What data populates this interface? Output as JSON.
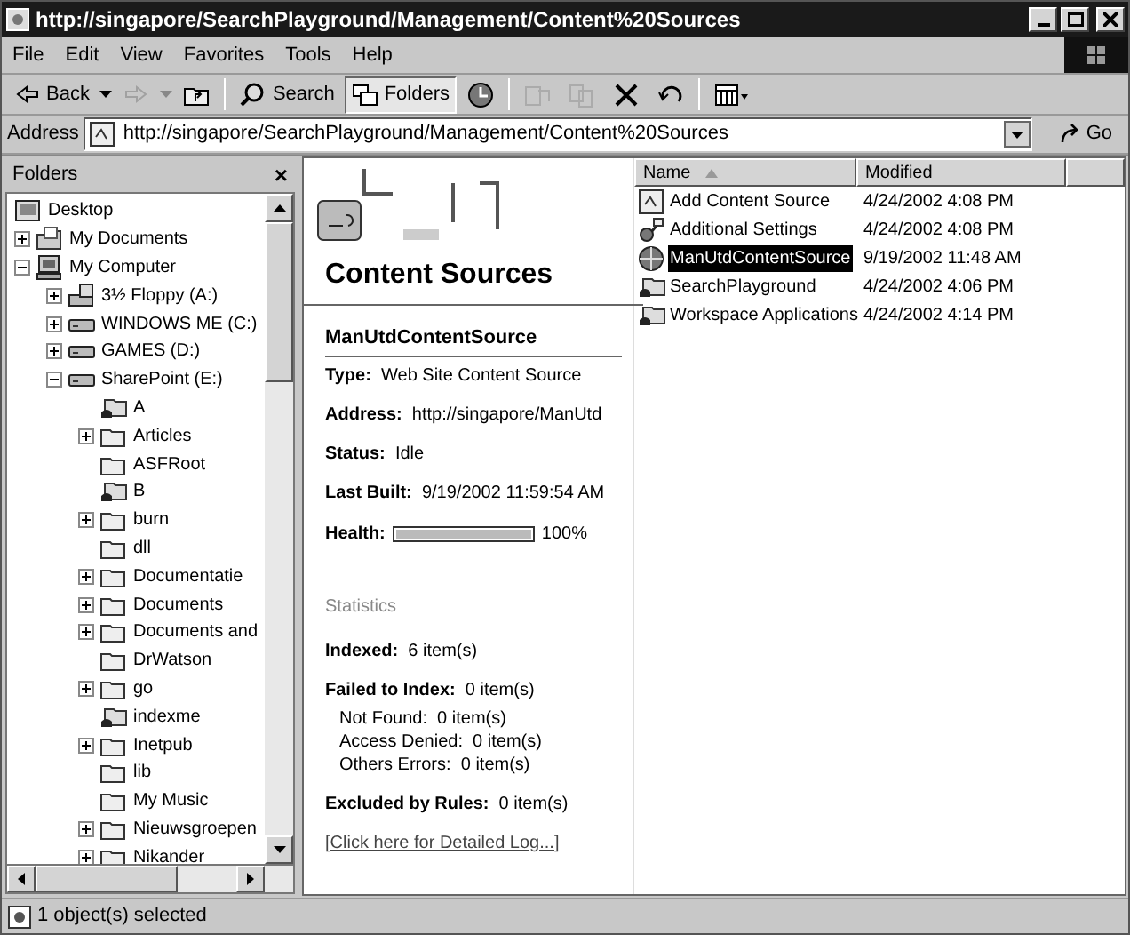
{
  "window": {
    "title": "http://singapore/SearchPlayground/Management/Content%20Sources"
  },
  "menu": [
    {
      "label": "File"
    },
    {
      "label": "Edit"
    },
    {
      "label": "View"
    },
    {
      "label": "Favorites"
    },
    {
      "label": "Tools"
    },
    {
      "label": "Help"
    }
  ],
  "toolbar": [
    {
      "kind": "back",
      "label": "Back",
      "disabled": false,
      "pressed": false
    },
    {
      "kind": "forward",
      "disabled": true,
      "pressed": false
    },
    {
      "kind": "up",
      "disabled": false,
      "pressed": false
    },
    {
      "kind": "search",
      "label": "Search",
      "disabled": false,
      "pressed": false
    },
    {
      "kind": "folders",
      "label": "Folders",
      "disabled": false,
      "pressed": true
    },
    {
      "kind": "history",
      "disabled": false,
      "pressed": false
    },
    {
      "kind": "move",
      "disabled": true,
      "pressed": false
    },
    {
      "kind": "copy",
      "disabled": true,
      "pressed": false
    },
    {
      "kind": "delete",
      "disabled": false,
      "pressed": false
    },
    {
      "kind": "undo",
      "disabled": false,
      "pressed": false
    },
    {
      "kind": "views",
      "disabled": false,
      "pressed": false
    }
  ],
  "address": {
    "label": "Address",
    "value": "http://singapore/SearchPlayground/Management/Content%20Sources",
    "go": "Go"
  },
  "folders": {
    "title": "Folders",
    "close": "×",
    "tree": [
      {
        "kind": "desktop",
        "label": "Desktop",
        "children": [
          {
            "kind": "documents",
            "label": "My Documents",
            "expanded": false
          },
          {
            "kind": "computer",
            "label": "My Computer",
            "expanded": true,
            "children": [
              {
                "kind": "floppy",
                "label": "3½ Floppy (A:)",
                "expanded": false
              },
              {
                "kind": "drive",
                "label": "WINDOWS ME (C:)",
                "expanded": false
              },
              {
                "kind": "drive",
                "label": "GAMES (D:)",
                "expanded": false
              },
              {
                "kind": "drive",
                "label": "SharePoint (E:)",
                "expanded": true,
                "children": [
                  {
                    "kind": "shared",
                    "label": "A"
                  },
                  {
                    "kind": "folder",
                    "label": "Articles",
                    "expanded": false
                  },
                  {
                    "kind": "folder",
                    "label": "ASFRoot"
                  },
                  {
                    "kind": "shared",
                    "label": "B"
                  },
                  {
                    "kind": "folder",
                    "label": "burn",
                    "expanded": false
                  },
                  {
                    "kind": "folder",
                    "label": "dll"
                  },
                  {
                    "kind": "folder",
                    "label": "Documentatie",
                    "expanded": false
                  },
                  {
                    "kind": "folder",
                    "label": "Documents",
                    "expanded": false
                  },
                  {
                    "kind": "folder",
                    "label": "Documents and",
                    "expanded": false
                  },
                  {
                    "kind": "folder",
                    "label": "DrWatson"
                  },
                  {
                    "kind": "folder",
                    "label": "go",
                    "expanded": false
                  },
                  {
                    "kind": "shared",
                    "label": "indexme"
                  },
                  {
                    "kind": "folder",
                    "label": "Inetpub",
                    "expanded": false
                  },
                  {
                    "kind": "folder",
                    "label": "lib"
                  },
                  {
                    "kind": "folder",
                    "label": "My Music"
                  },
                  {
                    "kind": "folder",
                    "label": "Nieuwsgroepen",
                    "expanded": false
                  },
                  {
                    "kind": "folder",
                    "label": "Nikander",
                    "expanded": false
                  }
                ]
              }
            ]
          }
        ]
      }
    ]
  },
  "webview": {
    "title": "Content Sources",
    "item": "ManUtdContentSource",
    "fields": [
      {
        "label": "Type:",
        "value": "Web Site Content Source"
      },
      {
        "label": "Address:",
        "value": "http://singapore/ManUtd"
      },
      {
        "label": "Status:",
        "value": "Idle"
      },
      {
        "label": "Last Built:",
        "value": "9/19/2002 11:59:54 AM"
      }
    ],
    "health": {
      "label": "Health:",
      "level": 1,
      "reading": "100%"
    },
    "statistics_heading": "Statistics",
    "statistics": [
      {
        "kind": "main",
        "label": "Indexed:",
        "value": "6 item(s)"
      },
      {
        "kind": "main",
        "label": "Failed to Index:",
        "value": "0 item(s)"
      },
      {
        "kind": "sub",
        "label": "Not Found:",
        "value": "0 item(s)"
      },
      {
        "kind": "sub",
        "label": "Access Denied:",
        "value": "0 item(s)"
      },
      {
        "kind": "sub",
        "label": "Others Errors:",
        "value": "0 item(s)"
      },
      {
        "kind": "main",
        "label": "Excluded by Rules:",
        "value": "0 item(s)"
      }
    ],
    "link": "[Click here for Detailed Log...]"
  },
  "list": {
    "columns": [
      {
        "label": "Name",
        "sorted": true
      },
      {
        "label": "Modified",
        "sorted": false
      }
    ],
    "rows": [
      {
        "kind": "page",
        "name": "Add Content Source",
        "modified": "4/24/2002 4:08 PM",
        "selected": false
      },
      {
        "kind": "settings",
        "name": "Additional Settings",
        "modified": "4/24/2002 4:08 PM",
        "selected": false
      },
      {
        "kind": "globe",
        "name": "ManUtdContentSource",
        "modified": "9/19/2002 11:48 AM",
        "selected": true
      },
      {
        "kind": "shared",
        "name": "SearchPlayground",
        "modified": "4/24/2002 4:06 PM",
        "selected": false
      },
      {
        "kind": "shared",
        "name": "Workspace Applications",
        "modified": "4/24/2002 4:14 PM",
        "selected": false
      }
    ]
  },
  "status_bar": {
    "text": "1 object(s) selected"
  }
}
